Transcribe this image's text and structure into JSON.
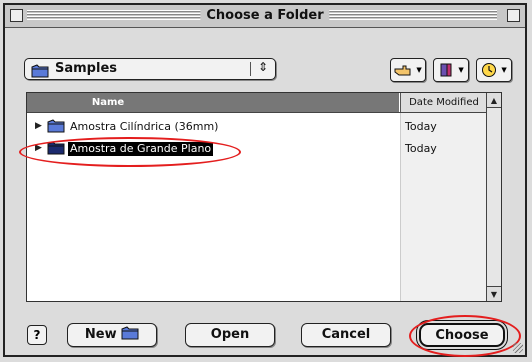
{
  "window": {
    "title": "Choose a Folder"
  },
  "location_popup": {
    "selected": "Samples",
    "arrows": "⇕"
  },
  "toolbar": {
    "shortcuts_icon": "pointing-hand-icon",
    "favorites_icon": "favorites-book-icon",
    "recent_icon": "clock-icon"
  },
  "list": {
    "columns": [
      "Name",
      "Date Modified"
    ],
    "rows": [
      {
        "name": "Amostra Cilíndrica (36mm)",
        "date": "Today",
        "selected": false
      },
      {
        "name": "Amostra de Grande Plano",
        "date": "Today",
        "selected": true
      }
    ]
  },
  "buttons": {
    "help": "?",
    "new_folder": "New",
    "open": "Open",
    "cancel": "Cancel",
    "choose": "Choose"
  },
  "colors": {
    "highlight_ring": "#e41e1e",
    "selection": "#000000",
    "header_name": "#777777"
  }
}
